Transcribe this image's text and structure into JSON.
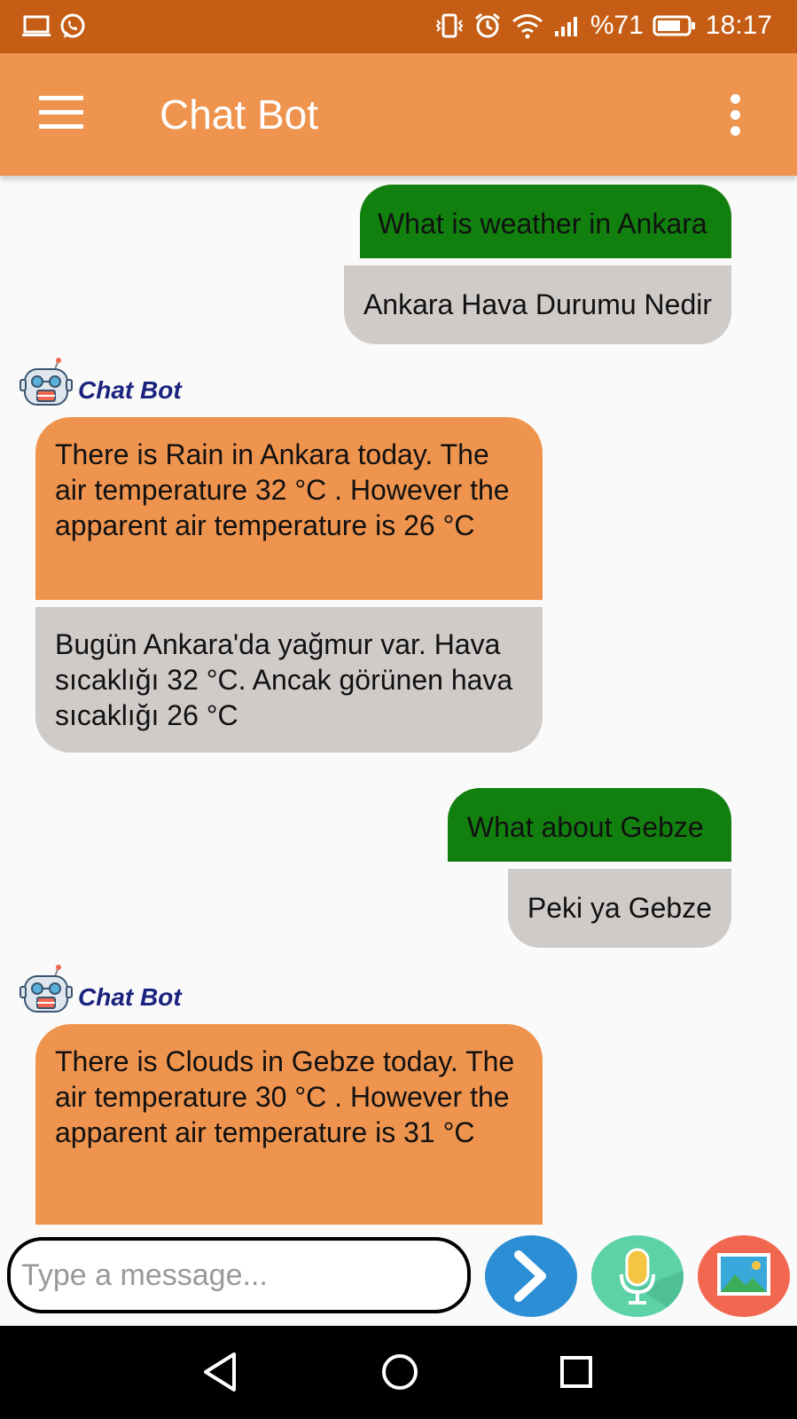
{
  "status_bar": {
    "battery": "%71",
    "time": "18:17"
  },
  "app_bar": {
    "title": "Chat Bot"
  },
  "messages": [
    {
      "en": "What is weather in Ankara",
      "tr": "Ankara Hava Durumu Nedir"
    },
    {
      "sender": "Chat Bot",
      "en": "There is Rain in Ankara today. The air temperature 32 °C . However the apparent air temperature is 26 °C",
      "tr": "Bugün Ankara'da yağmur var. Hava sıcaklığı 32 °C. Ancak görünen hava sıcaklığı 26 °C"
    },
    {
      "en": "What about Gebze",
      "tr": "Peki ya Gebze"
    },
    {
      "sender": "Chat Bot",
      "en": "There is Clouds in Gebze today. The air temperature 30 °C . However the apparent air temperature is 31 °C",
      "tr": ""
    }
  ],
  "input": {
    "placeholder": "Type a message..."
  },
  "colors": {
    "status_bar": "#c55e14",
    "app_bar": "#ef944e",
    "user_bubble": "#12800f",
    "translation_bubble": "#cfcbc9",
    "bot_bubble": "#ef944e",
    "bot_name": "#1a237e",
    "send": "#2c8fd6",
    "mic": "#5cd2a6",
    "image": "#f2674f"
  },
  "icons": [
    "laptop-icon",
    "whatsapp-icon",
    "vibrate-icon",
    "alarm-icon",
    "wifi-icon",
    "signal-icon",
    "battery-icon",
    "menu-icon",
    "more-vert-icon",
    "robot-icon",
    "send-icon",
    "mic-icon",
    "image-icon",
    "back-icon",
    "home-icon",
    "recents-icon"
  ]
}
